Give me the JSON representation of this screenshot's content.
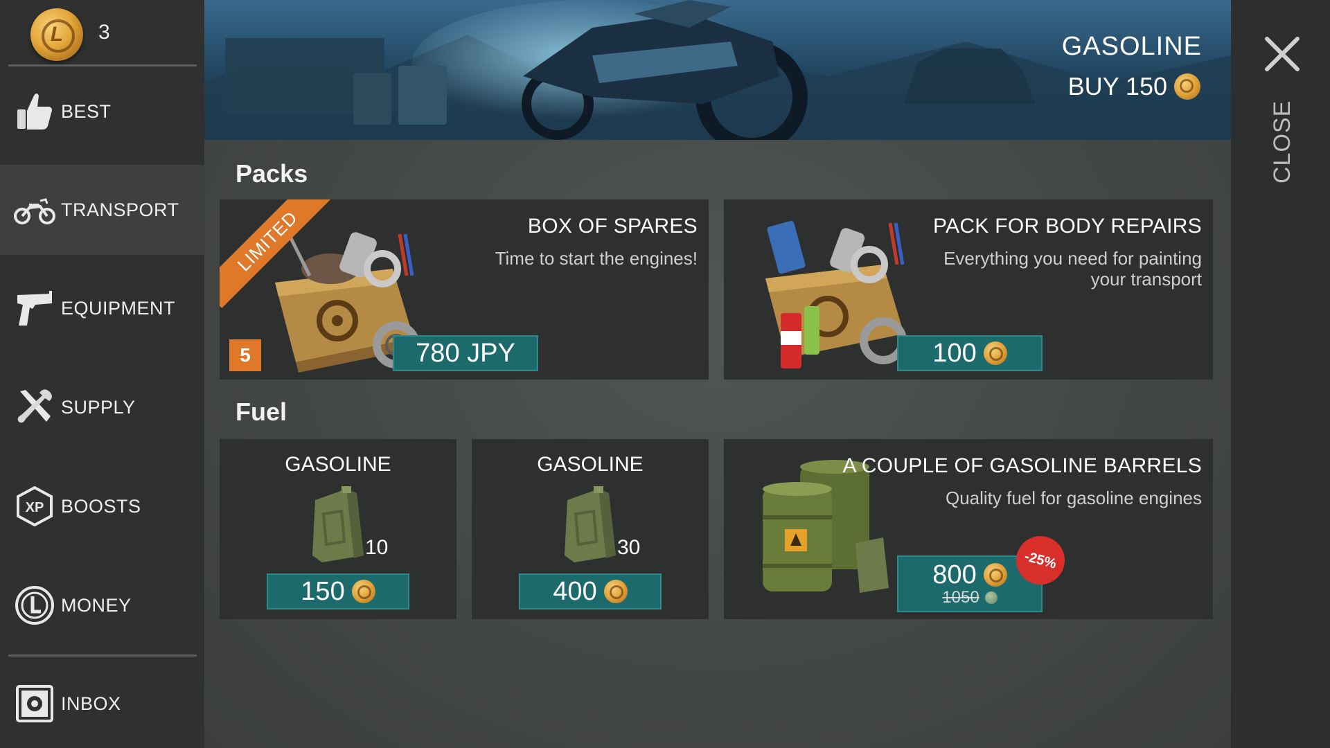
{
  "currency": {
    "count": "3",
    "coin_glyph": "L"
  },
  "nav": [
    {
      "label": "BEST",
      "icon": "thumbs-up-icon"
    },
    {
      "label": "TRANSPORT",
      "icon": "motorcycle-icon",
      "active": true
    },
    {
      "label": "EQUIPMENT",
      "icon": "pistol-icon"
    },
    {
      "label": "SUPPLY",
      "icon": "tools-icon"
    },
    {
      "label": "BOOSTS",
      "icon": "xp-icon"
    },
    {
      "label": "MONEY",
      "icon": "coin-icon"
    },
    {
      "label": "INBOX",
      "icon": "inbox-icon"
    }
  ],
  "banner": {
    "title": "GASOLINE",
    "buy_label": "BUY 150"
  },
  "close": {
    "label": "CLOSE"
  },
  "sections": {
    "packs": "Packs",
    "fuel": "Fuel"
  },
  "packs": [
    {
      "title": "BOX OF SPARES",
      "desc": "Time to start the engines!",
      "ribbon": "LIMITED",
      "count": "5",
      "price": "780 JPY"
    },
    {
      "title": "PACK FOR BODY REPAIRS",
      "desc": "Everything you need for painting your transport",
      "price": "100"
    }
  ],
  "fuel": [
    {
      "title": "GASOLINE",
      "qty": "10",
      "price": "150"
    },
    {
      "title": "GASOLINE",
      "qty": "30",
      "price": "400"
    },
    {
      "title": "A COUPLE OF GASOLINE BARRELS",
      "desc": "Quality fuel for gasoline engines",
      "price": "800",
      "old_price": "1050",
      "discount": "-25%"
    }
  ],
  "colors": {
    "accent_teal": "#1d6a6c",
    "orange": "#e0782a",
    "discount_red": "#d92f2a",
    "sidebar": "#2f3130"
  }
}
